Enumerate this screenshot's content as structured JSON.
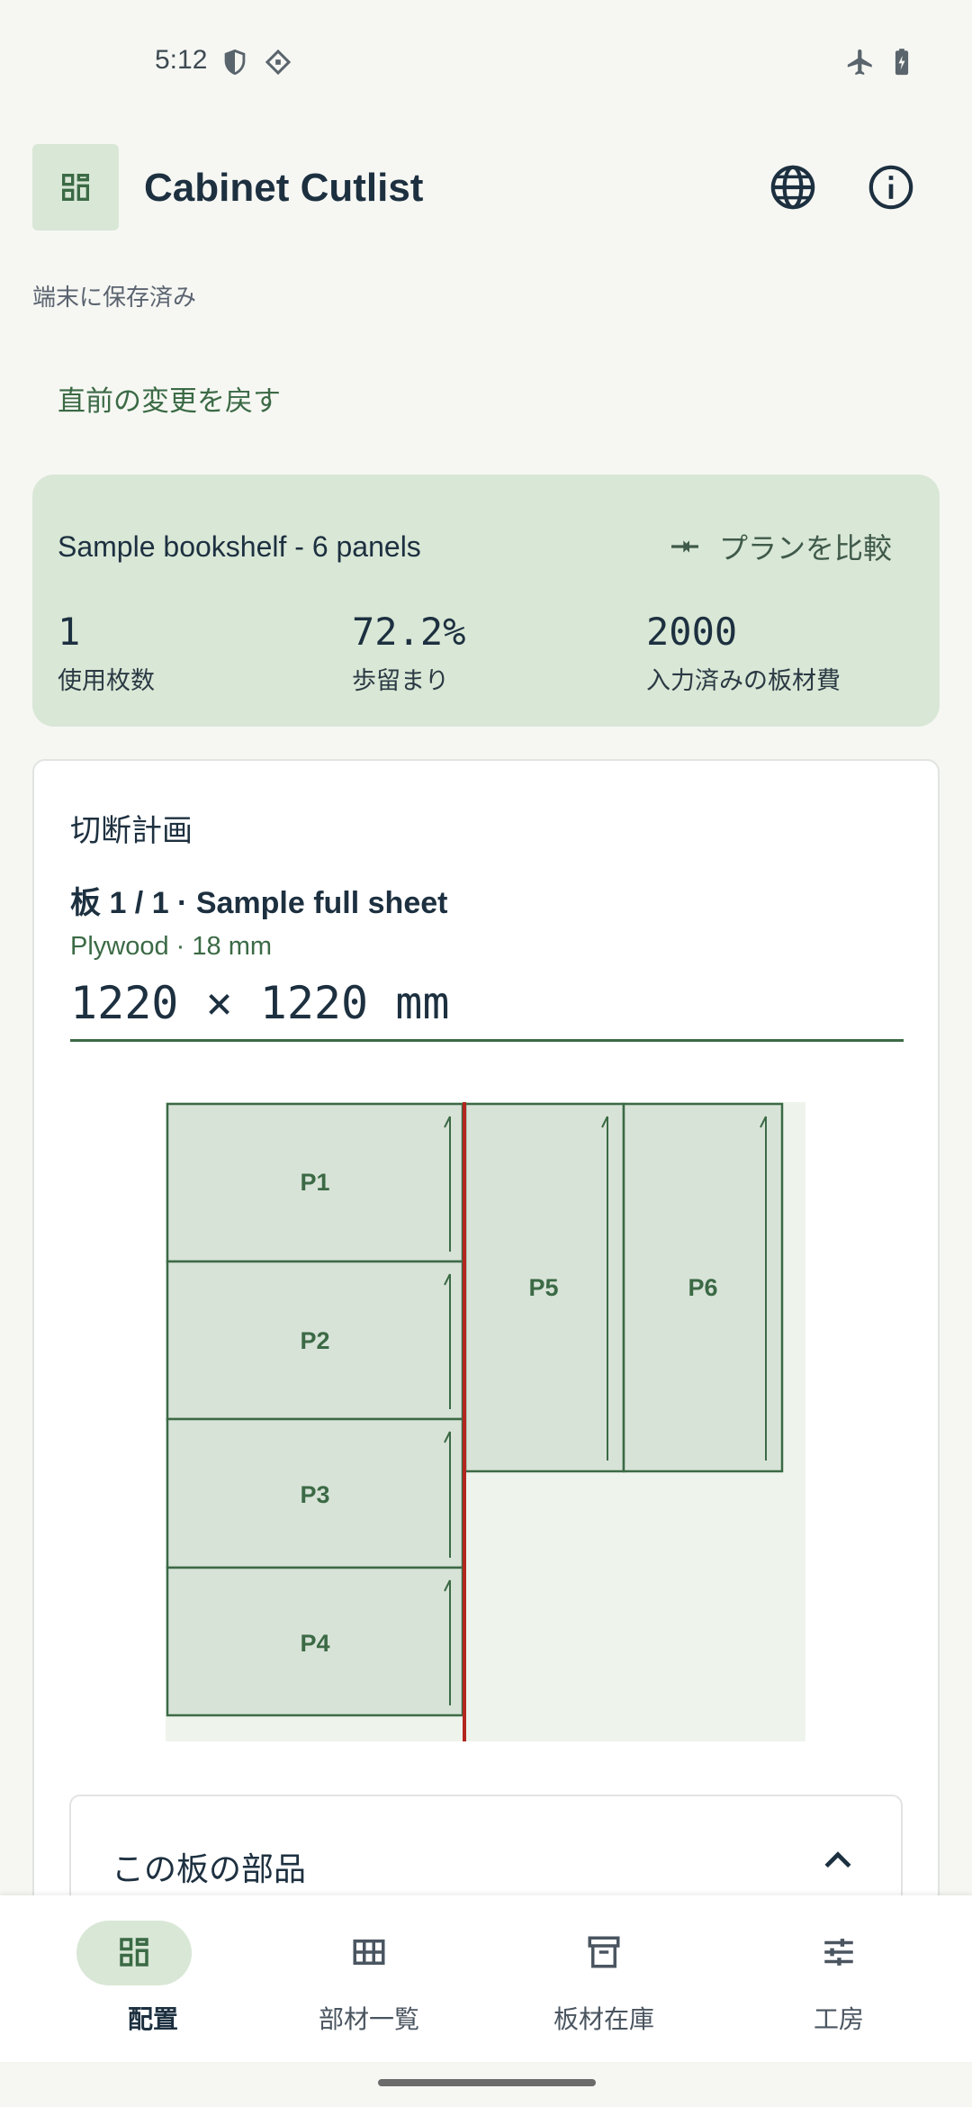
{
  "status_bar": {
    "time": "5:12",
    "icons": [
      "shield-icon",
      "vpn-diamond-icon",
      "airplane-icon",
      "battery-icon"
    ]
  },
  "app_bar": {
    "title": "Cabinet Cutlist",
    "logo_icon": "dashboard-icon",
    "actions": [
      "globe-icon",
      "info-icon"
    ]
  },
  "saved_status": "端末に保存済み",
  "undo_label": "直前の変更を戻す",
  "summary": {
    "plan_name": "Sample bookshelf - 6 panels",
    "compare_label": "プランを比較",
    "stats": [
      {
        "value": "1",
        "label": "使用枚数"
      },
      {
        "value": "72.2%",
        "label": "歩留まり"
      },
      {
        "value": "2000",
        "label": "入力済みの板材費"
      }
    ]
  },
  "cut_plan": {
    "heading": "切断計画",
    "sheet_title": "板 1 / 1 · Sample full sheet",
    "sheet_material": "Plywood · 18 mm",
    "sheet_size": "1220 × 1220 mm",
    "parts": [
      "P1",
      "P2",
      "P3",
      "P4",
      "P5",
      "P6"
    ]
  },
  "parts_panel": {
    "title": "この板の部品"
  },
  "bottom_nav": [
    {
      "label": "配置",
      "icon": "dashboard-icon",
      "active": true
    },
    {
      "label": "部材一覧",
      "icon": "table-grid-icon",
      "active": false
    },
    {
      "label": "板材在庫",
      "icon": "archive-box-icon",
      "active": false
    },
    {
      "label": "工房",
      "icon": "sliders-icon",
      "active": false
    }
  ],
  "colors": {
    "accent": "#3b6a45",
    "card_bg": "#d9e7d6",
    "part_fill": "#d8e3d8",
    "cut_line": "#b3261e",
    "sheet_bg": "#eef4ec",
    "page_bg": "#f6f7f3"
  }
}
